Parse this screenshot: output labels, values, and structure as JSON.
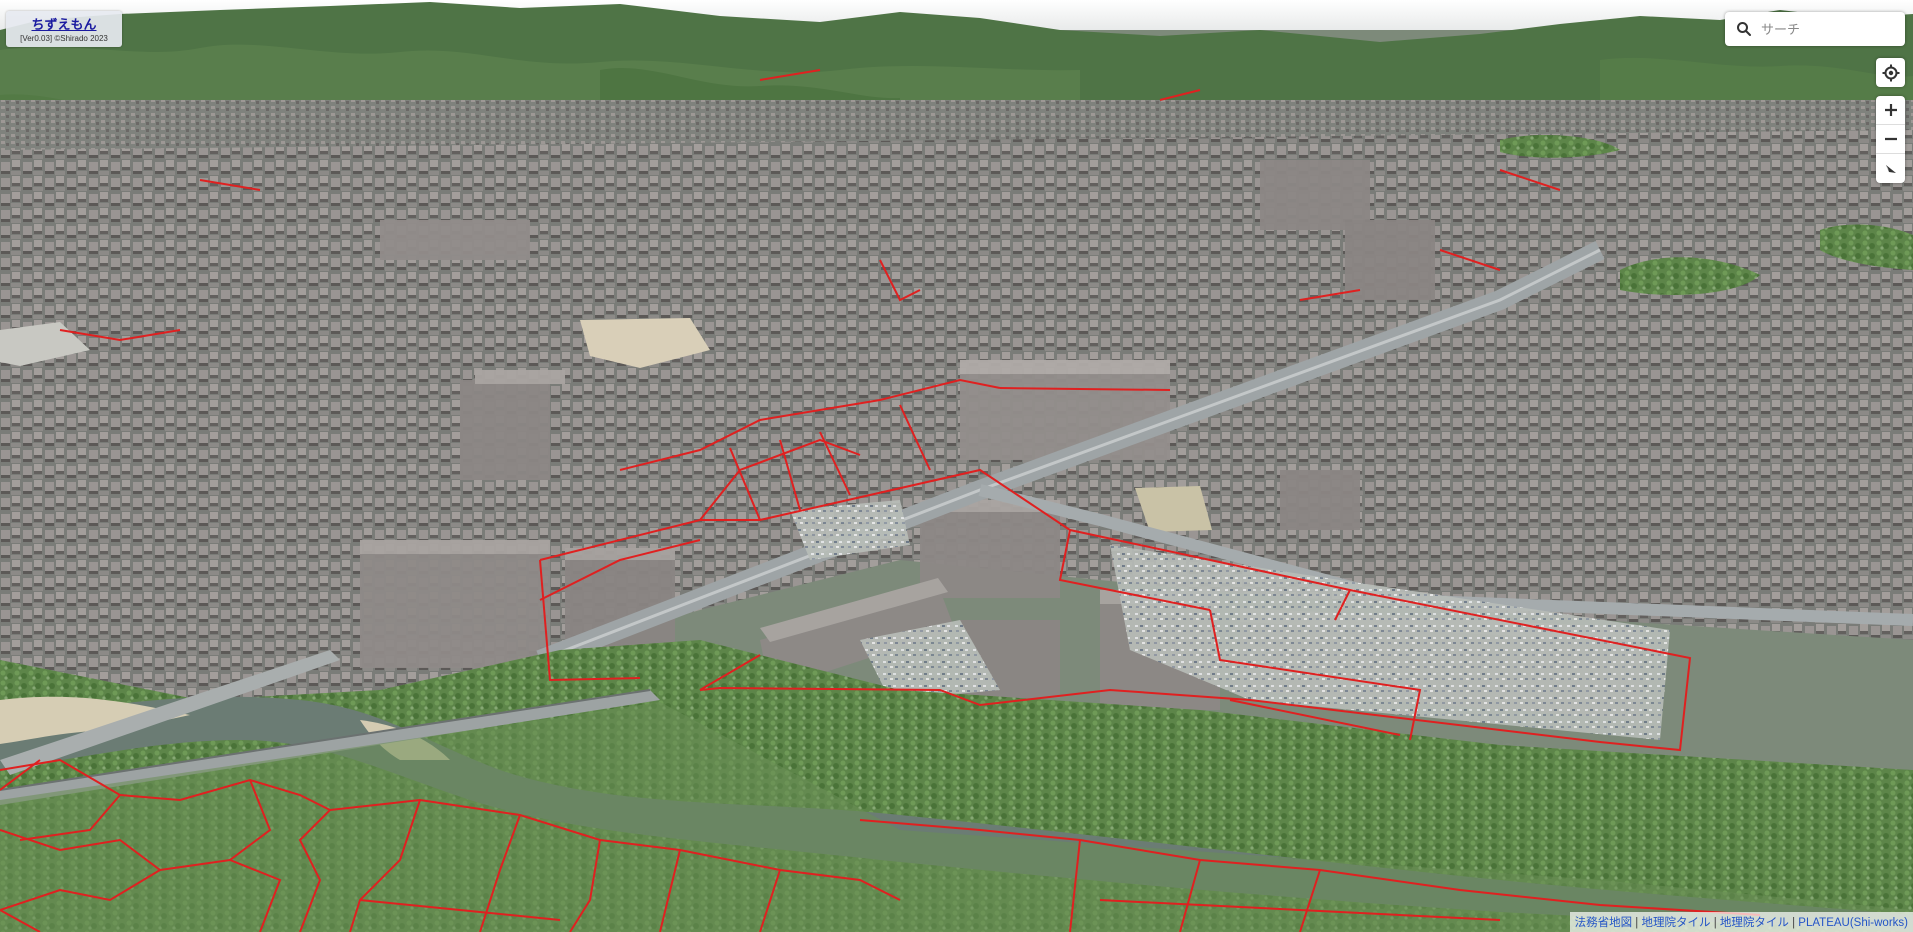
{
  "app": {
    "title": "ちずえもん",
    "version_line": "[Ver0.03]  ©Shirado 2023"
  },
  "search": {
    "placeholder": "サーチ",
    "icon": "search-icon"
  },
  "controls": {
    "geolocate_icon": "geolocate-icon",
    "zoom_in_icon": "plus-icon",
    "zoom_out_icon": "minus-icon",
    "compass_icon": "compass-icon"
  },
  "attribution": {
    "links": [
      "法務省地図",
      "地理院タイル",
      "地理院タイル",
      "PLATEAU(Shi-works)"
    ],
    "separator": "|"
  },
  "colors": {
    "parcel_lines": "#e02020",
    "buildings": "#8f8a88",
    "vegetation": "#5f8a50",
    "river": "#6d7e76",
    "link": "#2455c7"
  }
}
